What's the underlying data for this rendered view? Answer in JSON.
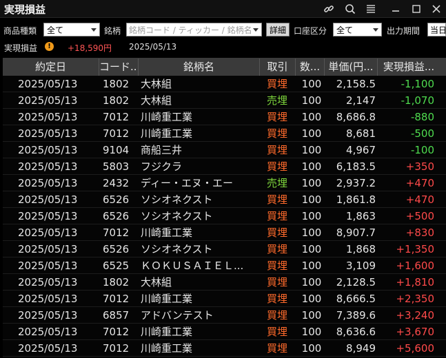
{
  "window": {
    "title": "実現損益",
    "icons": [
      "link-icon",
      "search-icon",
      "menu-icon",
      "minimize-icon",
      "maximize-icon",
      "close-icon"
    ]
  },
  "filters": {
    "product_label": "商品種類",
    "product_value": "全て",
    "symbol_label": "銘柄",
    "symbol_placeholder": "銘柄コード / ティッカー / 銘柄名",
    "detail_button": "詳細",
    "account_label": "口座区分",
    "account_value": "全て",
    "period_label": "出力期間",
    "period_value": "当日"
  },
  "summary": {
    "label": "実現損益",
    "warning_icon": "!",
    "amount": "+18,590円",
    "date": "2025/05/13"
  },
  "table": {
    "columns": [
      "約定日",
      "コード...",
      "銘柄名",
      "取引",
      "数...",
      "単価(円...",
      "実現損益..."
    ],
    "rows": [
      {
        "date": "2025/05/13",
        "code": "1802",
        "name": "大林組",
        "side": "買埋",
        "side_type": "buy",
        "qty": "100",
        "price": "2,158.5",
        "pl": "-1,100",
        "pl_type": "neg"
      },
      {
        "date": "2025/05/13",
        "code": "1802",
        "name": "大林組",
        "side": "売埋",
        "side_type": "sell",
        "qty": "100",
        "price": "2,147",
        "pl": "-1,070",
        "pl_type": "neg"
      },
      {
        "date": "2025/05/13",
        "code": "7012",
        "name": "川崎重工業",
        "side": "買埋",
        "side_type": "buy",
        "qty": "100",
        "price": "8,686.8",
        "pl": "-880",
        "pl_type": "neg"
      },
      {
        "date": "2025/05/13",
        "code": "7012",
        "name": "川崎重工業",
        "side": "買埋",
        "side_type": "buy",
        "qty": "100",
        "price": "8,681",
        "pl": "-500",
        "pl_type": "neg"
      },
      {
        "date": "2025/05/13",
        "code": "9104",
        "name": "商船三井",
        "side": "買埋",
        "side_type": "buy",
        "qty": "100",
        "price": "4,967",
        "pl": "-100",
        "pl_type": "neg"
      },
      {
        "date": "2025/05/13",
        "code": "5803",
        "name": "フジクラ",
        "side": "買埋",
        "side_type": "buy",
        "qty": "100",
        "price": "6,183.5",
        "pl": "+350",
        "pl_type": "pos"
      },
      {
        "date": "2025/05/13",
        "code": "2432",
        "name": "ディー・エヌ・エー",
        "side": "売埋",
        "side_type": "sell",
        "qty": "100",
        "price": "2,937.2",
        "pl": "+470",
        "pl_type": "pos"
      },
      {
        "date": "2025/05/13",
        "code": "6526",
        "name": "ソシオネクスト",
        "side": "買埋",
        "side_type": "buy",
        "qty": "100",
        "price": "1,861.8",
        "pl": "+470",
        "pl_type": "pos"
      },
      {
        "date": "2025/05/13",
        "code": "6526",
        "name": "ソシオネクスト",
        "side": "買埋",
        "side_type": "buy",
        "qty": "100",
        "price": "1,863",
        "pl": "+500",
        "pl_type": "pos"
      },
      {
        "date": "2025/05/13",
        "code": "7012",
        "name": "川崎重工業",
        "side": "買埋",
        "side_type": "buy",
        "qty": "100",
        "price": "8,907.7",
        "pl": "+830",
        "pl_type": "pos"
      },
      {
        "date": "2025/05/13",
        "code": "6526",
        "name": "ソシオネクスト",
        "side": "買埋",
        "side_type": "buy",
        "qty": "100",
        "price": "1,868",
        "pl": "+1,350",
        "pl_type": "pos"
      },
      {
        "date": "2025/05/13",
        "code": "6525",
        "name": "ＫＯＫＵＳＡＩＥＬ...",
        "side": "買埋",
        "side_type": "buy",
        "qty": "100",
        "price": "3,109",
        "pl": "+1,600",
        "pl_type": "pos"
      },
      {
        "date": "2025/05/13",
        "code": "1802",
        "name": "大林組",
        "side": "買埋",
        "side_type": "buy",
        "qty": "100",
        "price": "2,128.5",
        "pl": "+1,810",
        "pl_type": "pos"
      },
      {
        "date": "2025/05/13",
        "code": "7012",
        "name": "川崎重工業",
        "side": "買埋",
        "side_type": "buy",
        "qty": "100",
        "price": "8,666.5",
        "pl": "+2,350",
        "pl_type": "pos"
      },
      {
        "date": "2025/05/13",
        "code": "6857",
        "name": "アドバンテスト",
        "side": "買埋",
        "side_type": "buy",
        "qty": "100",
        "price": "7,389.6",
        "pl": "+3,240",
        "pl_type": "pos"
      },
      {
        "date": "2025/05/13",
        "code": "7012",
        "name": "川崎重工業",
        "side": "買埋",
        "side_type": "buy",
        "qty": "100",
        "price": "8,636.6",
        "pl": "+3,670",
        "pl_type": "pos"
      },
      {
        "date": "2025/05/13",
        "code": "7012",
        "name": "川崎重工業",
        "side": "買埋",
        "side_type": "buy",
        "qty": "100",
        "price": "8,949",
        "pl": "+5,600",
        "pl_type": "pos"
      }
    ]
  }
}
